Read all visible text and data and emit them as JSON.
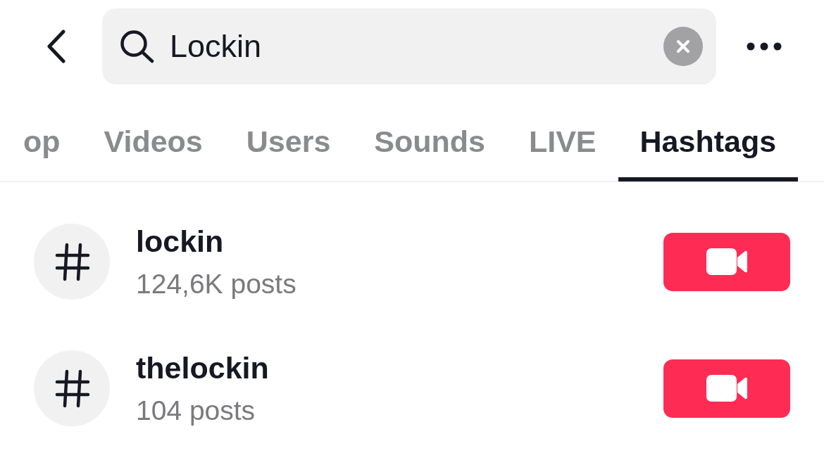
{
  "top_bar": {
    "search": {
      "value": "Lockin"
    }
  },
  "tabs": [
    {
      "label": "op",
      "selected": false
    },
    {
      "label": "Videos",
      "selected": false
    },
    {
      "label": "Users",
      "selected": false
    },
    {
      "label": "Sounds",
      "selected": false
    },
    {
      "label": "LIVE",
      "selected": false
    },
    {
      "label": "Hashtags",
      "selected": true
    }
  ],
  "hashtags": [
    {
      "name": "lockin",
      "posts": "124,6K posts"
    },
    {
      "name": "thelockin",
      "posts": "104 posts"
    }
  ]
}
